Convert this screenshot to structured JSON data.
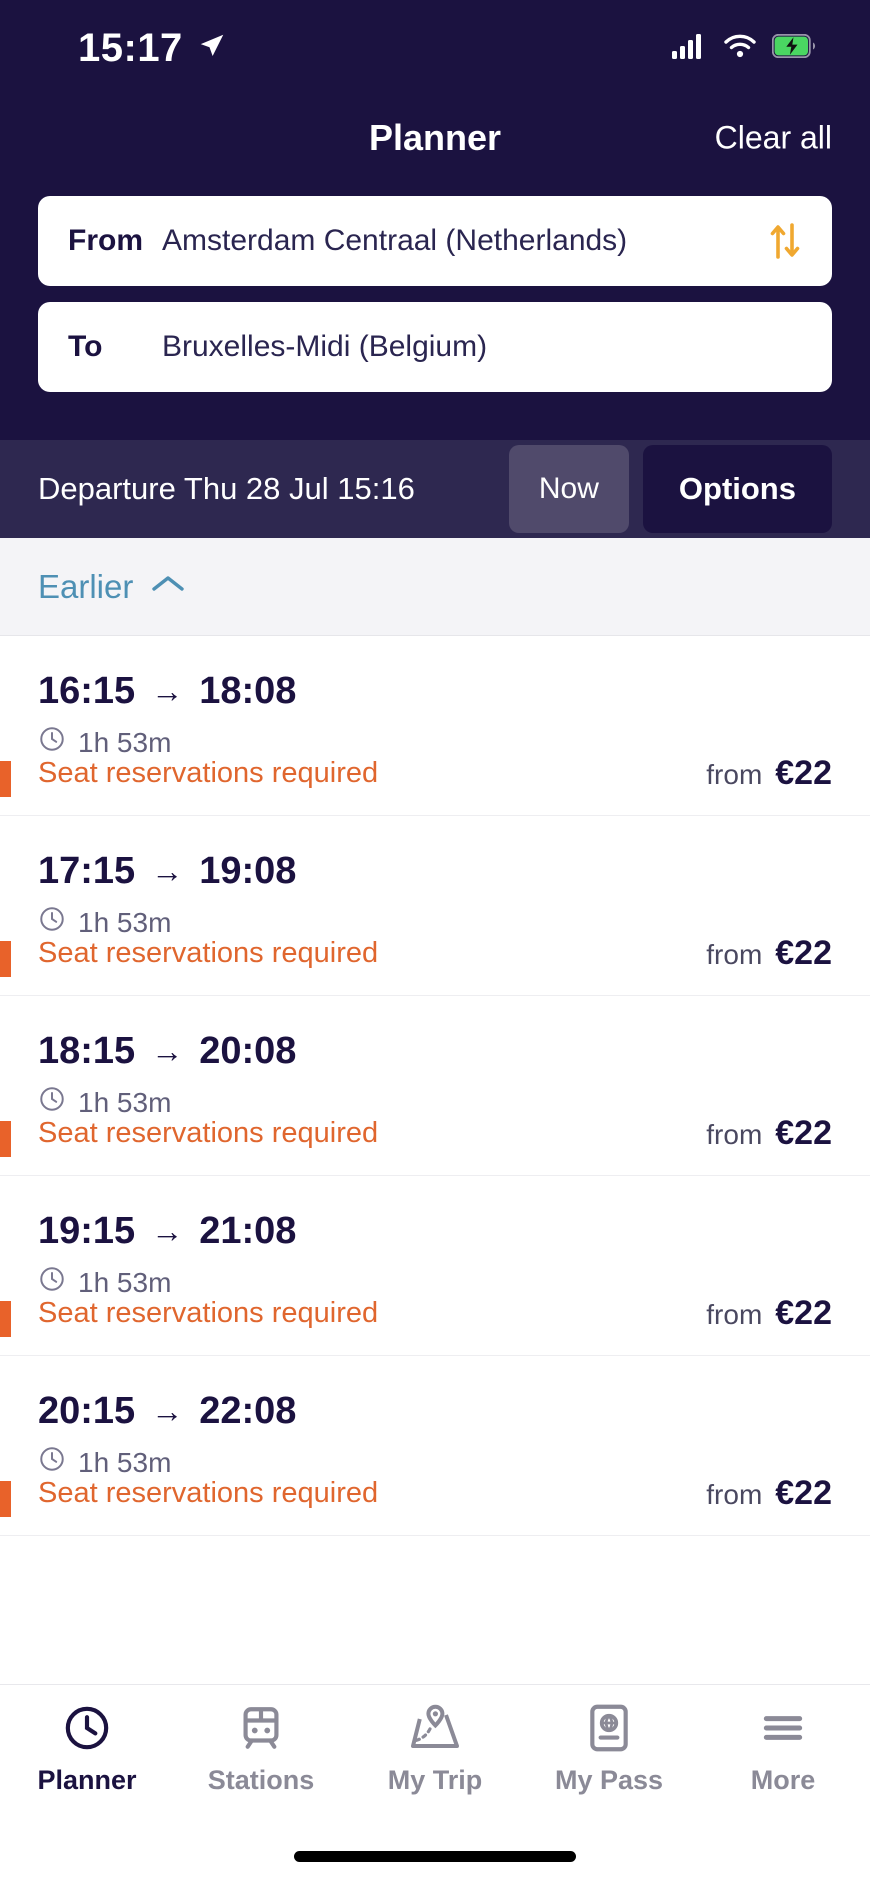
{
  "status_bar": {
    "time": "15:17",
    "location_icon": "location-arrow-icon",
    "signal_icon": "cellular-signal-icon",
    "wifi_icon": "wifi-icon",
    "battery_icon": "battery-charging-icon"
  },
  "header": {
    "title": "Planner",
    "clear_all_label": "Clear all",
    "background_color": "#1b1240",
    "from": {
      "label": "From",
      "value": "Amsterdam Centraal (Netherlands)"
    },
    "to": {
      "label": "To",
      "value": "Bruxelles-Midi (Belgium)"
    },
    "swap_icon": "swap-vertical-arrows-icon",
    "swap_icon_color": "#f0a830"
  },
  "departure_bar": {
    "text": "Departure Thu 28 Jul 15:16",
    "now_label": "Now",
    "options_label": "Options",
    "background_color": "#2e2850"
  },
  "earlier": {
    "label": "Earlier",
    "chevron_icon": "chevron-up-icon",
    "color": "#4e90b4"
  },
  "journeys": [
    {
      "departure": "16:15",
      "arrival": "18:08",
      "duration": "1h 53m",
      "warning": "Seat reservations required",
      "price_prefix": "from",
      "price": "€22"
    },
    {
      "departure": "17:15",
      "arrival": "19:08",
      "duration": "1h 53m",
      "warning": "Seat reservations required",
      "price_prefix": "from",
      "price": "€22"
    },
    {
      "departure": "18:15",
      "arrival": "20:08",
      "duration": "1h 53m",
      "warning": "Seat reservations required",
      "price_prefix": "from",
      "price": "€22"
    },
    {
      "departure": "19:15",
      "arrival": "21:08",
      "duration": "1h 53m",
      "warning": "Seat reservations required",
      "price_prefix": "from",
      "price": "€22"
    },
    {
      "departure": "20:15",
      "arrival": "22:08",
      "duration": "1h 53m",
      "warning": "Seat reservations required",
      "price_prefix": "from",
      "price": "€22"
    }
  ],
  "arrow_glyph": "→",
  "warning_color": "#e0662e",
  "tabs": [
    {
      "label": "Planner",
      "icon": "clock-icon",
      "active": true
    },
    {
      "label": "Stations",
      "icon": "train-icon",
      "active": false
    },
    {
      "label": "My Trip",
      "icon": "map-pin-icon",
      "active": false
    },
    {
      "label": "My Pass",
      "icon": "passport-globe-icon",
      "active": false
    },
    {
      "label": "More",
      "icon": "hamburger-menu-icon",
      "active": false
    }
  ]
}
